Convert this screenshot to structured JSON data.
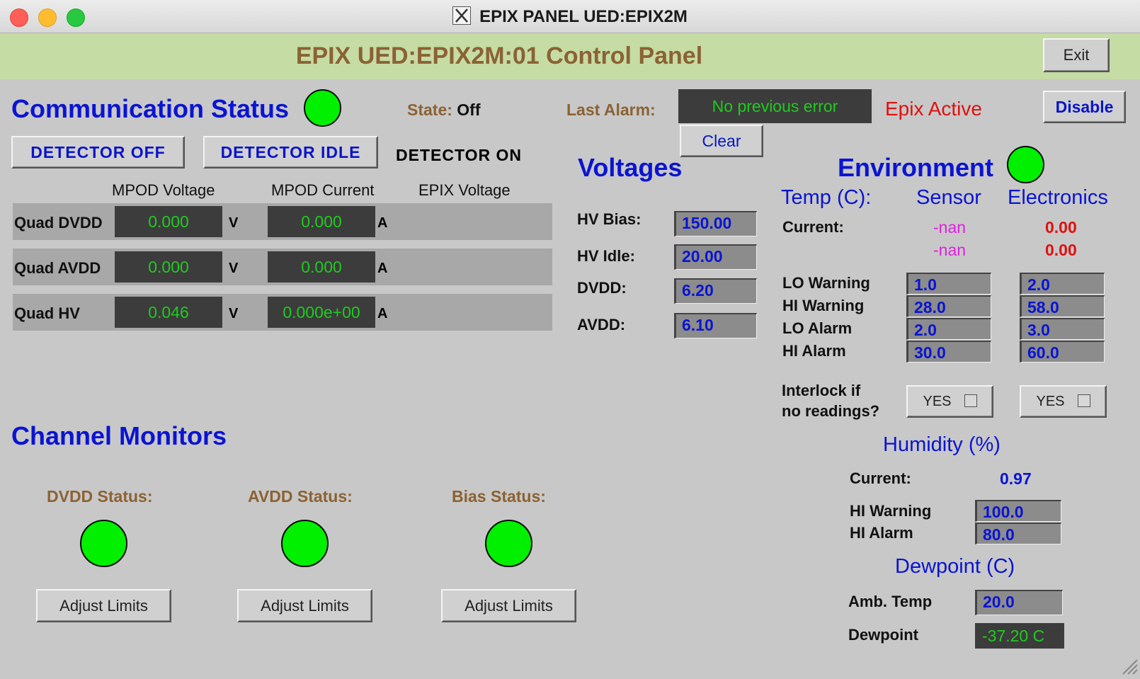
{
  "window": {
    "title": "EPIX PANEL UED:EPIX2M"
  },
  "header": {
    "title": "EPIX UED:EPIX2M:01 Control Panel",
    "exit_label": "Exit"
  },
  "status": {
    "comm_title": "Communication Status",
    "state_label": "State:",
    "state_value": "Off",
    "last_alarm_label": "Last Alarm:",
    "last_alarm_value": "No previous error",
    "clear_label": "Clear",
    "epix_active": "Epix Active",
    "disable_label": "Disable"
  },
  "detector": {
    "off": "DETECTOR OFF",
    "idle": "DETECTOR IDLE",
    "on": "DETECTOR ON"
  },
  "table": {
    "headers": [
      "MPOD Voltage",
      "MPOD Current",
      "EPIX Voltage"
    ],
    "rows": [
      {
        "label": "Quad DVDD",
        "voltage": "0.000",
        "vunit": "V",
        "current": "0.000",
        "cunit": "A"
      },
      {
        "label": "Quad AVDD",
        "voltage": "0.000",
        "vunit": "V",
        "current": "0.000",
        "cunit": "A"
      },
      {
        "label": "Quad HV",
        "voltage": "0.046",
        "vunit": "V",
        "current": "0.000e+00",
        "cunit": "A"
      }
    ]
  },
  "voltages": {
    "title": "Voltages",
    "items": [
      {
        "label": "HV Bias:",
        "value": "150.00"
      },
      {
        "label": "HV Idle:",
        "value": "20.00"
      },
      {
        "label": "DVDD:",
        "value": "6.20"
      },
      {
        "label": "AVDD:",
        "value": "6.10"
      }
    ]
  },
  "environment": {
    "title": "Environment",
    "temp_label": "Temp (C):",
    "col_sensor": "Sensor",
    "col_electronics": "Electronics",
    "current_label": "Current:",
    "sensor_current": [
      "-nan",
      "-nan"
    ],
    "electronics_current": [
      "0.00",
      "0.00"
    ],
    "limits": [
      {
        "label": "LO Warning",
        "sensor": "1.0",
        "electronics": "2.0"
      },
      {
        "label": "HI Warning",
        "sensor": "28.0",
        "electronics": "58.0"
      },
      {
        "label": "LO Alarm",
        "sensor": "2.0",
        "electronics": "3.0"
      },
      {
        "label": "HI Alarm",
        "sensor": "30.0",
        "electronics": "60.0"
      }
    ],
    "interlock_label_1": "Interlock if",
    "interlock_label_2": "no readings?",
    "interlock_sensor": "YES",
    "interlock_electronics": "YES"
  },
  "humidity": {
    "title": "Humidity (%)",
    "current_label": "Current:",
    "current_value": "0.97",
    "hi_warning_label": "HI Warning",
    "hi_warning_value": "100.0",
    "hi_alarm_label": "HI Alarm",
    "hi_alarm_value": "80.0"
  },
  "dewpoint": {
    "title": "Dewpoint (C)",
    "amb_label": "Amb. Temp",
    "amb_value": "20.0",
    "dew_label": "Dewpoint",
    "dew_value": "-37.20 C"
  },
  "channels": {
    "title": "Channel Monitors",
    "items": [
      {
        "label": "DVDD Status:",
        "button": "Adjust Limits"
      },
      {
        "label": "AVDD Status:",
        "button": "Adjust Limits"
      },
      {
        "label": "Bias Status:",
        "button": "Adjust Limits"
      }
    ]
  },
  "colors": {
    "header_band": "#c5dca4",
    "title_brown": "#8b6234",
    "heading_blue": "#0a14d2",
    "led_green": "#00f000",
    "alarm_red": "#e01010",
    "nan_magenta": "#e020e0",
    "readout_green": "#1ecc1e"
  }
}
